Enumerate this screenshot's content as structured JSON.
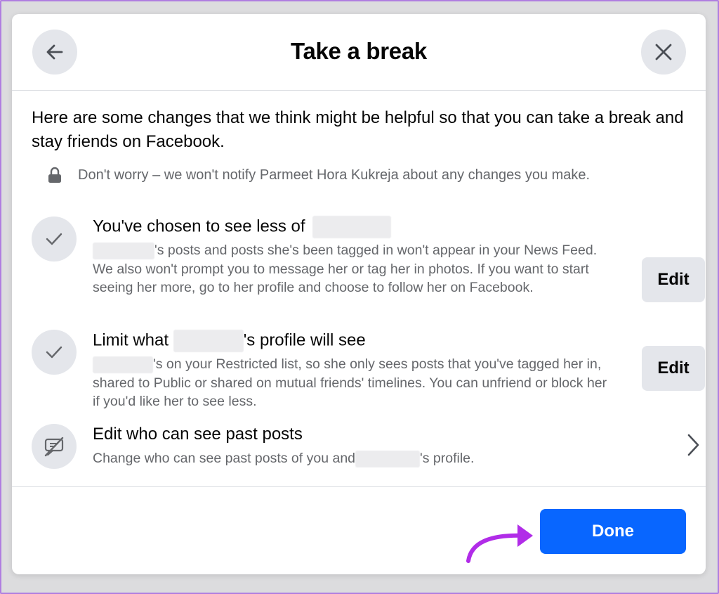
{
  "dialog": {
    "title": "Take a break",
    "intro": "Here are some changes that we think might be helpful so that you can take a break and stay friends on Facebook.",
    "notice": "Don't worry – we won't notify Parmeet Hora Kukreja about any changes you make."
  },
  "sections": [
    {
      "title": "You've chosen to see less of",
      "desc_suffix": "'s posts and posts she's been tagged in won't appear in your News Feed. We also won't prompt you to message her or tag her in photos. If you want to start seeing her more, go to her profile and choose to follow her on Facebook.",
      "action": "Edit"
    },
    {
      "title_prefix": "Limit what",
      "title_suffix": "'s profile will see",
      "desc_suffix": "'s on your Restricted list, so she only sees posts that you've tagged her in, shared to Public or shared on mutual friends' timelines. You can unfriend or block her if you'd like her to see less.",
      "action": "Edit"
    },
    {
      "title": "Edit who can see past posts",
      "desc_prefix": "Change who can see past posts of you and",
      "desc_suffix": "'s profile."
    }
  ],
  "footer": {
    "done_label": "Done"
  },
  "colors": {
    "primary": "#0866ff",
    "annotation_arrow": "#b12ce8",
    "frame_border": "#b07ee0"
  },
  "icons": [
    "back-arrow-icon",
    "close-icon",
    "lock-icon",
    "checkmark-icon",
    "speech-bubble-slash-icon",
    "chevron-right-icon"
  ]
}
